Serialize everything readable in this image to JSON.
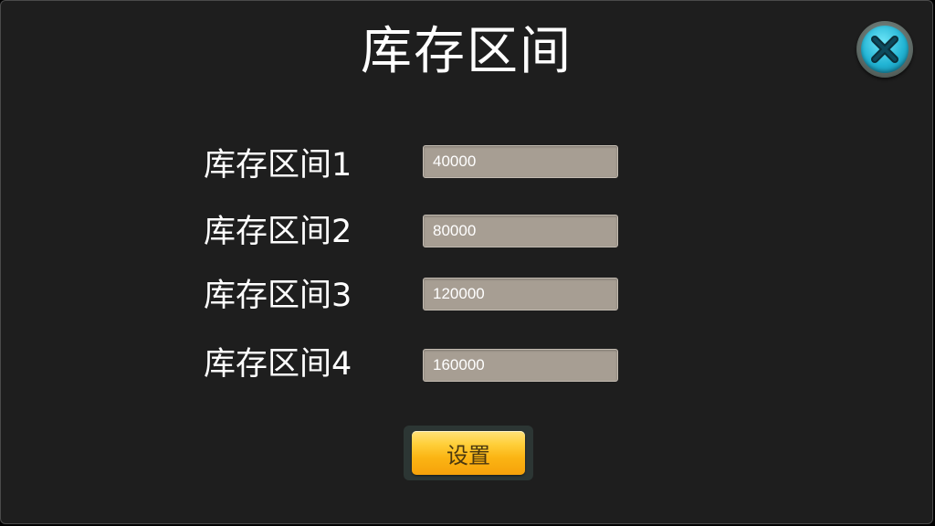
{
  "dialog": {
    "title": "库存区间",
    "close_icon": "close-icon",
    "rows": [
      {
        "label": "库存区间1",
        "value": "40000"
      },
      {
        "label": "库存区间2",
        "value": "80000"
      },
      {
        "label": "库存区间3",
        "value": "120000"
      },
      {
        "label": "库存区间4",
        "value": "160000"
      }
    ],
    "set_label": "设置"
  },
  "colors": {
    "background": "#1e1e1e",
    "input_bg": "#a79e93",
    "button_yellow": "#fbb514",
    "close_cyan": "#22b4d4"
  }
}
